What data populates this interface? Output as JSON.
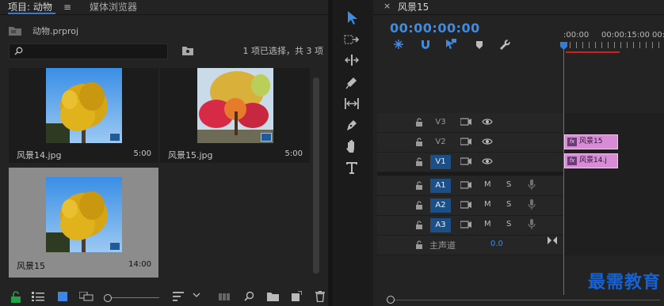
{
  "project": {
    "tab_label": "项目: 动物",
    "tab_menu": "≡",
    "other_tab_label": "媒体浏览器",
    "file_name": "动物.prproj",
    "search_placeholder": "",
    "selection_status": "1 项已选择，共 3 项",
    "items": [
      {
        "name": "风景14.jpg",
        "duration": "5:00",
        "selected": false,
        "badge": "still-image-icon"
      },
      {
        "name": "风景15.jpg",
        "duration": "5:00",
        "selected": false,
        "badge": "still-image-icon"
      },
      {
        "name": "风景15",
        "duration": "14:00",
        "selected": true,
        "badge": "sequence-icon"
      }
    ]
  },
  "timeline": {
    "sequence_tab": "风景15",
    "close_glyph": "×",
    "timecode": "00:00:00:00",
    "ruler": [
      ":00:00",
      "00:00:15:00",
      "00:"
    ],
    "tracks": [
      {
        "id": "V3",
        "kind": "video",
        "active": false
      },
      {
        "id": "V2",
        "kind": "video",
        "active": false
      },
      {
        "id": "V1",
        "kind": "video",
        "active": true
      },
      {
        "id": "A1",
        "kind": "audio",
        "active": true,
        "mute": "M",
        "solo": "S"
      },
      {
        "id": "A2",
        "kind": "audio",
        "active": true,
        "mute": "M",
        "solo": "S"
      },
      {
        "id": "A3",
        "kind": "audio",
        "active": true,
        "mute": "M",
        "solo": "S"
      }
    ],
    "master_label": "主声道",
    "master_value": "0.0",
    "clips": [
      {
        "track": "V2",
        "label": "风景15",
        "fx": "fx"
      },
      {
        "track": "V1",
        "label": "风景14.j",
        "fx": "fx"
      }
    ]
  },
  "watermark": "最需教育",
  "colors": {
    "accent_blue": "#2e7de0",
    "timecode_blue": "#3e8be6",
    "clip_pink": "#d98cd6",
    "in_out_red": "#d21e1e",
    "panel_bg": "#232323"
  }
}
